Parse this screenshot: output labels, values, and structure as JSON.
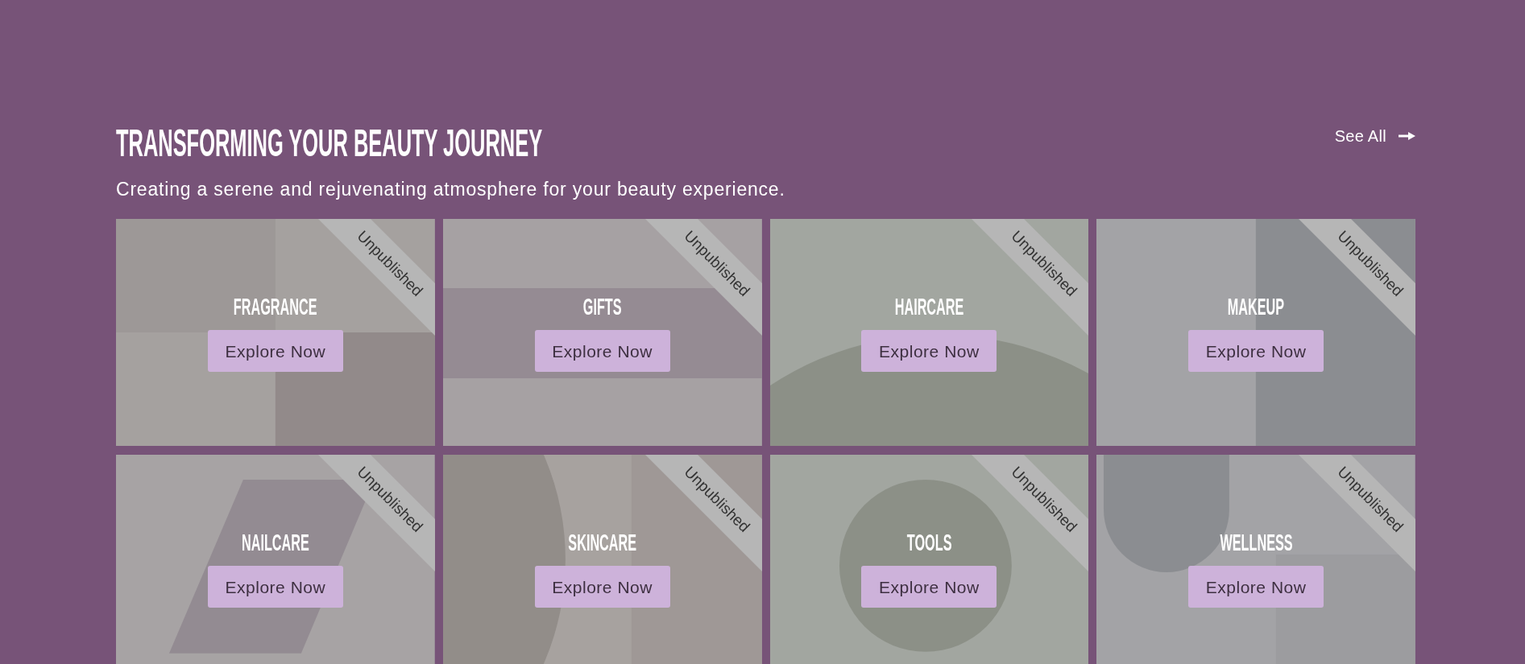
{
  "section": {
    "title": "TRANSFORMING YOUR BEAUTY JOURNEY",
    "subtitle": "Creating a serene and rejuvenating atmosphere for your beauty experience.",
    "see_all": "See All"
  },
  "categories": [
    {
      "name": "FRAGRANCE",
      "status": "Unpublished",
      "button": "Explore Now"
    },
    {
      "name": "GIFTS",
      "status": "Unpublished",
      "button": "Explore Now"
    },
    {
      "name": "HAIRCARE",
      "status": "Unpublished",
      "button": "Explore Now"
    },
    {
      "name": "MAKEUP",
      "status": "Unpublished",
      "button": "Explore Now"
    },
    {
      "name": "NAILCARE",
      "status": "Unpublished",
      "button": "Explore Now"
    },
    {
      "name": "SKINCARE",
      "status": "Unpublished",
      "button": "Explore Now"
    },
    {
      "name": "TOOLS",
      "status": "Unpublished",
      "button": "Explore Now"
    },
    {
      "name": "WELLNESS",
      "status": "Unpublished",
      "button": "Explore Now"
    }
  ]
}
